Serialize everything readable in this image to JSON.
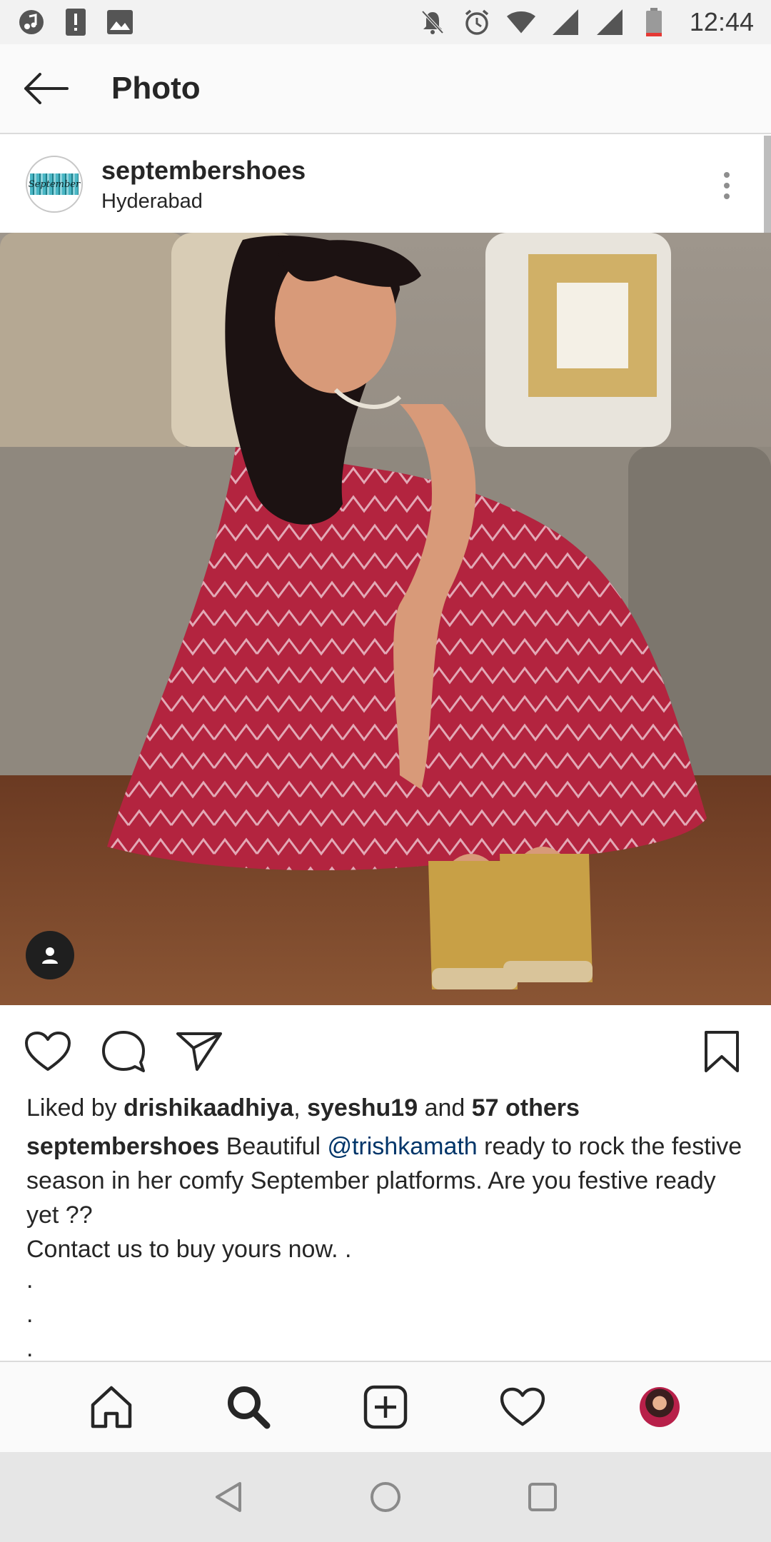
{
  "status_bar": {
    "time": "12:44",
    "left_icons": [
      "music-icon",
      "alert-icon",
      "image-icon"
    ],
    "right_icons": [
      "muted-bell-icon",
      "alarm-icon",
      "wifi-icon",
      "signal-icon",
      "signal-icon",
      "battery-icon"
    ]
  },
  "header": {
    "title": "Photo"
  },
  "post": {
    "avatar_text": "September",
    "username": "septembershoes",
    "location": "Hyderabad"
  },
  "likes": {
    "prefix": "Liked by",
    "user1": "drishikaadhiya",
    "separator": ",",
    "user2": "syeshu19",
    "and": "and",
    "others": "57 others"
  },
  "caption": {
    "username": "septembershoes",
    "text1": "Beautiful",
    "mention": "@trishkamath",
    "text2": "ready to rock the festive season in her comfy September platforms. Are you festive ready yet ??",
    "line2": "Contact us to buy yours now. .",
    "dots": [
      ".",
      ".",
      "."
    ]
  },
  "colors": {
    "accent_link": "#003569",
    "text": "#262626",
    "divider": "#dbdbdb"
  }
}
